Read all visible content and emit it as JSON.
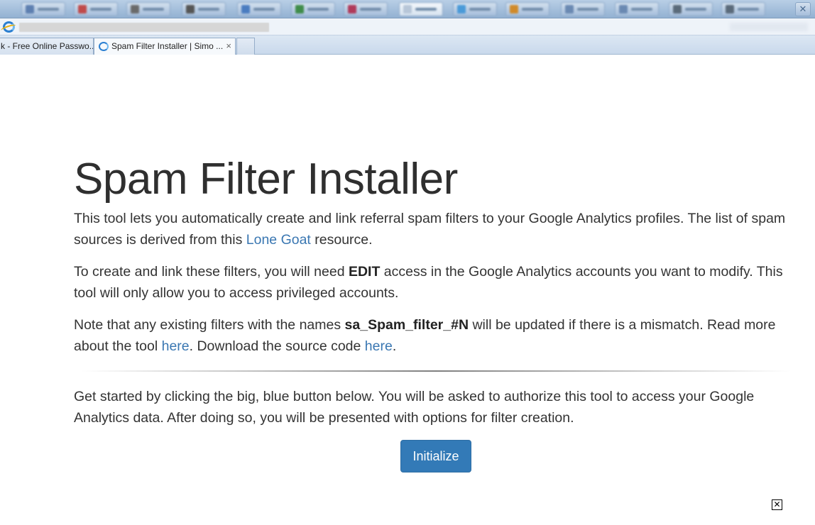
{
  "browser": {
    "tabs": [
      {
        "title": "k - Free Online Passwo...",
        "active": false
      },
      {
        "title": "Spam Filter Installer | Simo ...",
        "active": true
      }
    ],
    "tab_close_glyph": "×",
    "taskbar_close_glyph": "✕"
  },
  "page": {
    "title": "Spam Filter Installer",
    "p1": {
      "before": "This tool lets you automatically create and link referral spam filters to your Google Analytics profiles. The list of spam sources is derived from this ",
      "link": "Lone Goat",
      "after": " resource."
    },
    "p2": {
      "before": "To create and link these filters, you will need ",
      "bold": "EDIT",
      "after": " access in the Google Analytics accounts you want to modify. This tool will only allow you to access privileged accounts."
    },
    "p3": {
      "before": "Note that any existing filters with the names ",
      "bold": "sa_Spam_filter_#N",
      "middle": " will be updated if there is a mismatch. Read more about the tool ",
      "link1": "here",
      "between": ". Download the source code ",
      "link2": "here",
      "after": "."
    },
    "p4": "Get started by clicking the big, blue button below. You will be asked to authorize this tool to access your Google Analytics data. After doing so, you will be presented with options for filter creation.",
    "button_label": "Initialize"
  },
  "overlay": {
    "close_glyph": "✕"
  },
  "colors": {
    "link": "#3a77b2",
    "button_bg": "#337ab7",
    "text": "#333333"
  }
}
